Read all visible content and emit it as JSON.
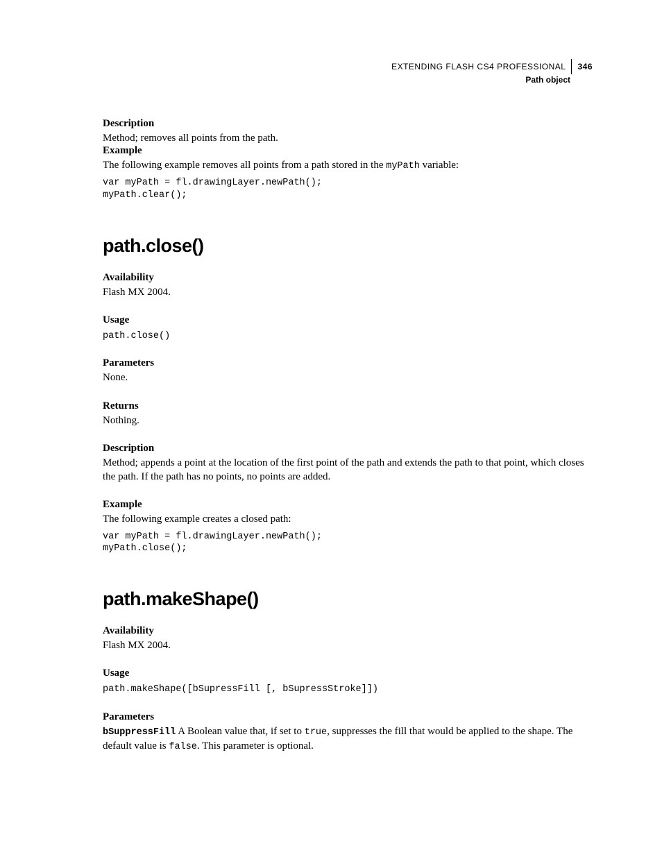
{
  "header": {
    "book_title": "EXTENDING FLASH CS4 PROFESSIONAL",
    "page_number": "346",
    "chapter": "Path object"
  },
  "sec1": {
    "desc_h": "Description",
    "desc_b": "Method; removes all points from the path.",
    "ex_h": "Example",
    "ex_b1": "The following example removes all points from a path stored in the ",
    "ex_var": "myPath",
    "ex_b2": " variable:",
    "code": "var myPath = fl.drawingLayer.newPath();\nmyPath.clear();"
  },
  "close": {
    "title": "path.close()",
    "avail_h": "Availability",
    "avail_b": "Flash MX 2004.",
    "usage_h": "Usage",
    "usage_code": "path.close()",
    "params_h": "Parameters",
    "params_b": "None.",
    "returns_h": "Returns",
    "returns_b": "Nothing.",
    "desc_h": "Description",
    "desc_b": "Method; appends a point at the location of the first point of the path and extends the path to that point, which closes the path. If the path has no points, no points are added.",
    "ex_h": "Example",
    "ex_b": "The following example creates a closed path:",
    "code": "var myPath = fl.drawingLayer.newPath();\nmyPath.close();"
  },
  "makeShape": {
    "title": "path.makeShape()",
    "avail_h": "Availability",
    "avail_b": "Flash MX 2004.",
    "usage_h": "Usage",
    "usage_code": "path.makeShape([bSupressFill [, bSupressStroke]])",
    "params_h": "Parameters",
    "p1_name": "bSuppressFill",
    "p1_b1": "  A Boolean value that, if set to ",
    "p1_true": "true",
    "p1_b2": ", suppresses the fill that would be applied to the shape. The default value is ",
    "p1_false": "false",
    "p1_b3": ". This parameter is optional."
  }
}
